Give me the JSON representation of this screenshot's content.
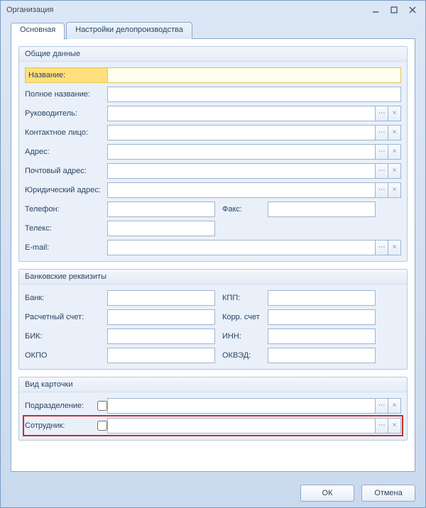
{
  "window": {
    "title": "Организация"
  },
  "tabs": {
    "main": "Основная",
    "settings": "Настройки делопроизводства"
  },
  "groups": {
    "general": "Общие данные",
    "bank": "Банковские реквизиты",
    "card": "Вид карточки"
  },
  "labels": {
    "name": "Название:",
    "full_name": "Полное название:",
    "manager": "Руководитель:",
    "contact": "Контактное лицо:",
    "address": "Адрес:",
    "postal": "Почтовый адрес:",
    "legal": "Юридический адрес:",
    "phone": "Телефон:",
    "fax": "Факс:",
    "telex": "Телекс:",
    "email": "E-mail:",
    "bank": "Банк:",
    "acc": "Расчетный счет:",
    "bik": "БИК:",
    "okpo": "ОКПО",
    "kpp": "КПП:",
    "corr": "Корр. счет",
    "inn": "ИНН:",
    "okved": "ОКВЭД:",
    "dept": "Подразделение:",
    "emp": "Сотрудник:"
  },
  "values": {
    "name": "",
    "full_name": "",
    "manager": "",
    "contact": "",
    "address": "",
    "postal": "",
    "legal": "",
    "phone": "",
    "fax": "",
    "telex": "",
    "email": "",
    "bank": "",
    "acc": "",
    "bik": "",
    "okpo": "",
    "kpp": "",
    "corr": "",
    "inn": "",
    "okved": "",
    "dept": "",
    "emp": ""
  },
  "checks": {
    "dept": false,
    "emp": false
  },
  "glyphs": {
    "ellipsis": "⋯",
    "clear": "×"
  },
  "buttons": {
    "ok": "ОК",
    "cancel": "Отмена"
  }
}
